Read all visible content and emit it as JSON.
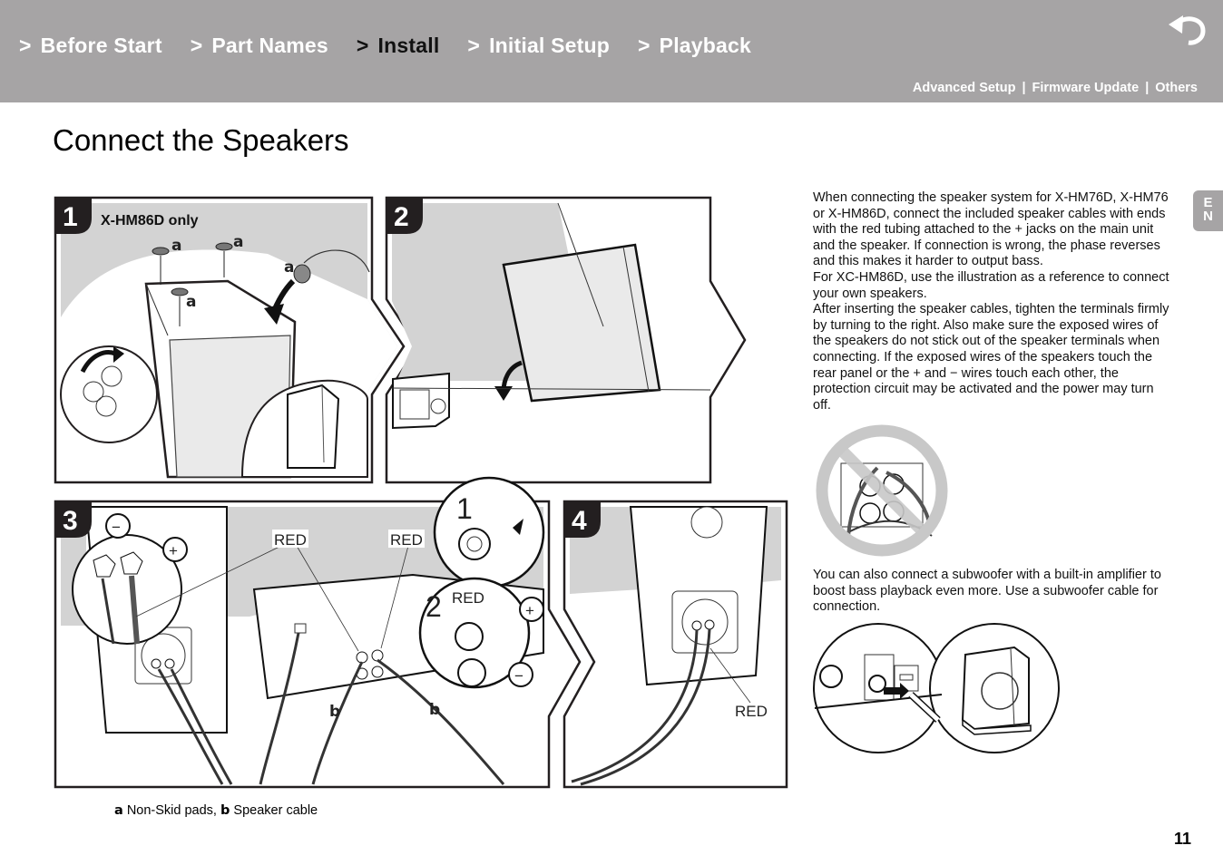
{
  "header": {
    "nav": [
      {
        "chevron": ">",
        "label": "Before Start",
        "active": false
      },
      {
        "chevron": ">",
        "label": "Part Names",
        "active": false
      },
      {
        "chevron": ">",
        "label": "Install",
        "active": true
      },
      {
        "chevron": ">",
        "label": "Initial Setup",
        "active": false
      },
      {
        "chevron": ">",
        "label": "Playback",
        "active": false
      }
    ],
    "back_icon": "return-arrow-icon",
    "subnav": [
      {
        "label": "Advanced Setup"
      },
      {
        "label": "Firmware Update"
      },
      {
        "label": "Others"
      }
    ],
    "subnav_separator": "|"
  },
  "page": {
    "title": "Connect the Speakers",
    "language_tab": {
      "line1": "E",
      "line2": "N"
    },
    "page_number": "11"
  },
  "figures": {
    "step1": {
      "number": "1",
      "heading": "X-HM86D only",
      "pad_label": "a"
    },
    "step2": {
      "number": "2"
    },
    "step3": {
      "number": "3",
      "red_label": "RED",
      "cable_label": "b",
      "inset_steps": [
        "1",
        "2"
      ],
      "minus_symbol": "−",
      "plus_symbol": "+"
    },
    "step4": {
      "number": "4",
      "red_label": "RED"
    },
    "caption": {
      "a_key": "a",
      "a_text": " Non-Skid pads, ",
      "b_key": "b",
      "b_text": " Speaker cable"
    }
  },
  "body": {
    "paragraph1": [
      "When connecting the speaker system for X-HM76D, X-HM76 or X-HM86D, connect the included speaker cables with ends with the red tubing attached to the + jacks on the main unit and the speaker. If connection is wrong, the phase reverses and this makes it harder to output bass.",
      "For XC-HM86D, use the illustration as a reference to connect your own speakers.",
      "After inserting the speaker cables, tighten the terminals firmly by turning to the right. Also make sure the exposed wires of the speakers do not stick out of the speaker terminals when connecting. If the exposed wires of the speakers touch the rear panel or the + and − wires touch each other, the protection circuit may be activated and the power may turn off."
    ],
    "paragraph2": "You can also connect a subwoofer with a built-in amplifier to boost bass playback even more. Use a subwoofer cable for connection."
  },
  "colors": {
    "header_bg": "#a6a4a5",
    "nav_text": "#ffffff",
    "nav_active": "#111111",
    "illustration_gray": "#d3d3d3",
    "step_badge": "#231f20"
  }
}
